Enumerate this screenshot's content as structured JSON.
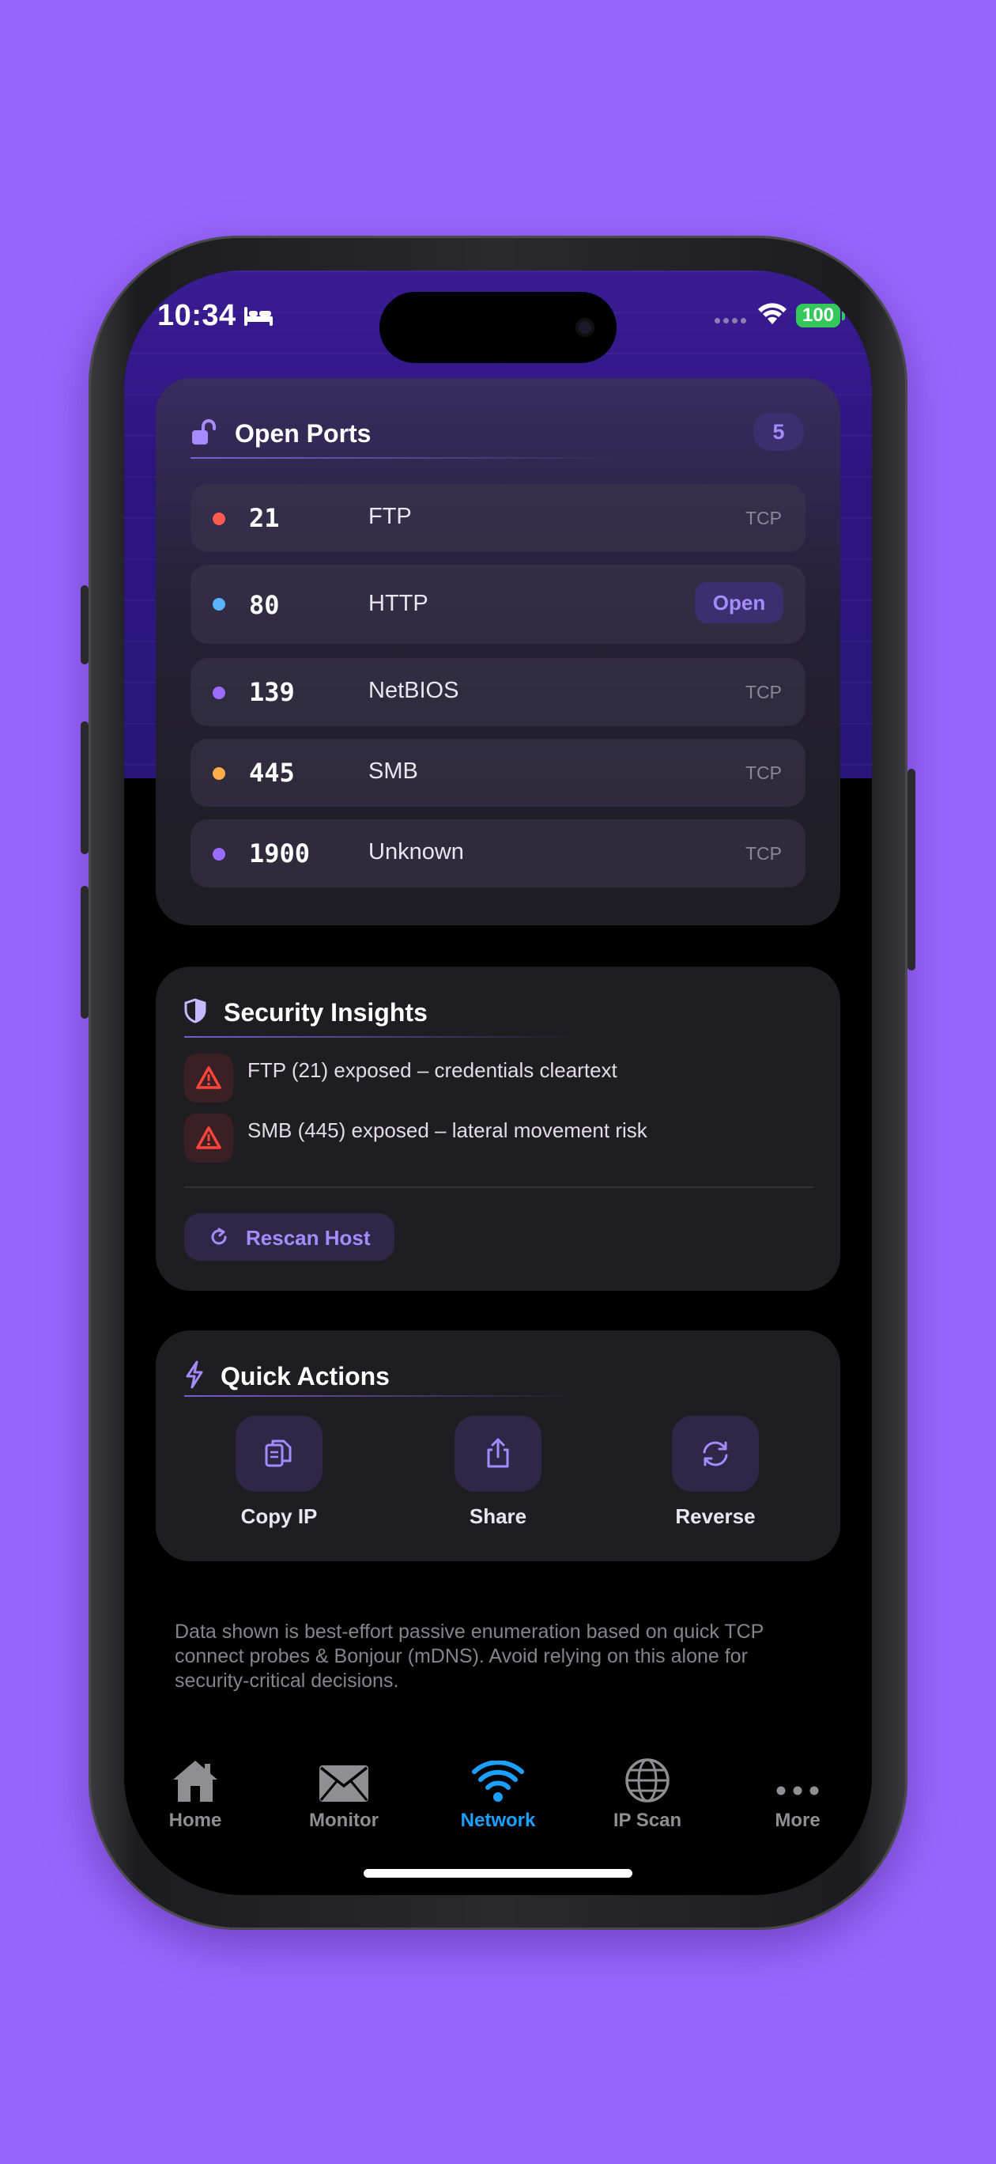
{
  "status_bar": {
    "time": "10:34",
    "battery": "100"
  },
  "open_ports": {
    "title": "Open Ports",
    "count": "5",
    "rows": [
      {
        "port": "21",
        "service": "FTP",
        "tag": "TCP",
        "dot_color": "#ff5a4f"
      },
      {
        "port": "80",
        "service": "HTTP",
        "action": "Open",
        "dot_color": "#58b4ff"
      },
      {
        "port": "139",
        "service": "NetBIOS",
        "tag": "TCP",
        "dot_color": "#9b6cff"
      },
      {
        "port": "445",
        "service": "SMB",
        "tag": "TCP",
        "dot_color": "#ffad4a"
      },
      {
        "port": "1900",
        "service": "Unknown",
        "tag": "TCP",
        "dot_color": "#9b6cff"
      }
    ]
  },
  "security": {
    "title": "Security Insights",
    "insights": [
      "FTP (21) exposed – credentials cleartext",
      "SMB (445) exposed – lateral movement risk"
    ],
    "rescan_label": "Rescan Host"
  },
  "quick_actions": {
    "title": "Quick Actions",
    "items": [
      {
        "label": "Copy IP",
        "icon": "copy-icon"
      },
      {
        "label": "Share",
        "icon": "share-icon"
      },
      {
        "label": "Reverse",
        "icon": "reverse-icon"
      }
    ]
  },
  "disclaimer": "Data shown is best-effort passive enumeration based on quick TCP connect probes & Bonjour (mDNS). Avoid relying on this alone for security-critical decisions.",
  "tab_bar": {
    "active": "Network",
    "tabs": [
      {
        "label": "Home",
        "icon": "house-icon"
      },
      {
        "label": "Monitor",
        "icon": "envelope-icon"
      },
      {
        "label": "Network",
        "icon": "wifi-icon"
      },
      {
        "label": "IP Scan",
        "icon": "globe-icon"
      },
      {
        "label": "More",
        "icon": "ellipsis-icon"
      }
    ]
  },
  "colors": {
    "background": "#9966fd",
    "accent": "#a68bff",
    "active_tab": "#1aa0ff",
    "warning": "#ff453a"
  }
}
